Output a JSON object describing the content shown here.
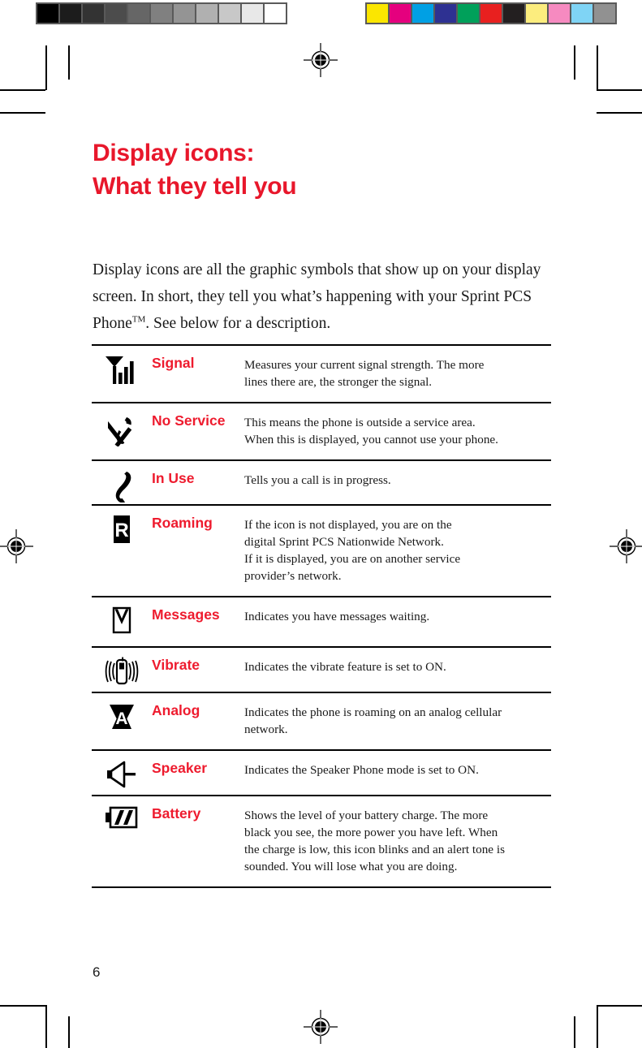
{
  "document": {
    "page_number": "6",
    "title_lines": [
      "Display icons:",
      "What they tell you"
    ],
    "title_color": "#e8172b",
    "label_color": "#ee1b2e",
    "intro_text_1": "Display icons are all the graphic symbols that show up on your display screen. In short, they tell you what’s happening with your Sprint PCS Phone",
    "intro_superscript": "TM",
    "intro_text_2": ". See below for a description."
  },
  "calibration": {
    "grayscale_label": "grayscale-calibration-strip",
    "grayscale_patches": [
      "#000000",
      "#1c1c1c",
      "#333333",
      "#4c4c4c",
      "#666666",
      "#808080",
      "#949494",
      "#b0b0b0",
      "#c8c8c8",
      "#e8e8e8",
      "#ffffff"
    ],
    "color_label": "color-calibration-strip",
    "color_patches": [
      "#fbe600",
      "#e5007e",
      "#00a0e4",
      "#2e3192",
      "#00a05a",
      "#e8201f",
      "#231f20",
      "#fced7e",
      "#f68ac0",
      "#7fd4f5",
      "#919191"
    ]
  },
  "table": {
    "rows": [
      {
        "icon": "signal-bars-icon",
        "name": "Signal",
        "lines": [
          "Measures your current signal strength. The more",
          "lines there are, the stronger the signal."
        ]
      },
      {
        "icon": "no-service-handset-icon",
        "name": "No Service",
        "lines": [
          "This means the phone is outside a service area.",
          "When this is displayed, you cannot use your phone."
        ]
      },
      {
        "icon": "in-use-handset-icon",
        "name": "In Use",
        "lines": [
          "Tells you a call is in progress."
        ]
      },
      {
        "icon": "roaming-r-icon",
        "name": "Roaming",
        "lines": [
          "If the icon is not displayed, you are on the",
          "digital Sprint PCS Nationwide Network.",
          "If it is displayed, you are on another service",
          "provider’s network."
        ]
      },
      {
        "icon": "messages-envelope-icon",
        "name": "Messages",
        "lines": [
          "Indicates you have messages waiting."
        ]
      },
      {
        "icon": "vibrate-phone-icon",
        "name": "Vibrate",
        "lines": [
          "Indicates the vibrate feature is set to ON."
        ]
      },
      {
        "icon": "analog-a-icon",
        "name": "Analog",
        "lines": [
          "Indicates the phone is roaming on an analog cellular",
          "network."
        ]
      },
      {
        "icon": "speaker-icon",
        "name": "Speaker",
        "lines": [
          "Indicates the Speaker Phone mode is set to ON."
        ]
      },
      {
        "icon": "battery-icon",
        "name": "Battery",
        "lines": [
          "Shows the level of your battery charge. The more",
          "black you see, the more power you have left. When",
          "the charge is low, this icon blinks and an alert tone is",
          "sounded. You will lose what you are doing."
        ]
      }
    ]
  }
}
